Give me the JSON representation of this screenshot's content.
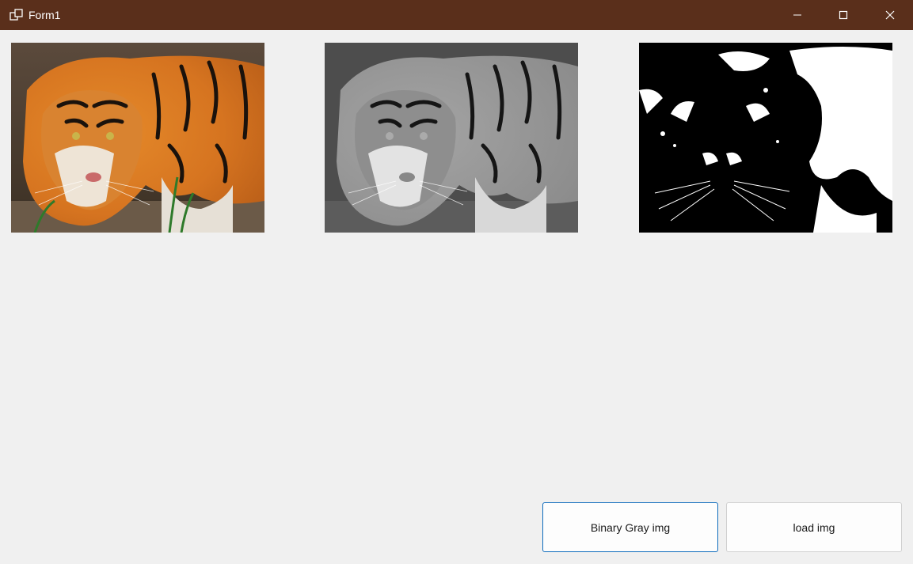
{
  "window": {
    "title": "Form1",
    "titlebar_color": "#5a2f1b",
    "icons": {
      "app": "window-app-icon",
      "minimize": "minimize-icon",
      "maximize": "maximize-icon",
      "close": "close-icon"
    }
  },
  "images": [
    {
      "name": "original",
      "kind": "color tiger photo"
    },
    {
      "name": "grayscale",
      "kind": "grayscale tiger photo"
    },
    {
      "name": "binary",
      "kind": "binary black-white tiger photo"
    }
  ],
  "buttons": {
    "binary_gray": "Binary Gray img",
    "load": "load img"
  },
  "colors": {
    "background": "#f0f0f0",
    "accent_border": "#0f6cbd"
  }
}
